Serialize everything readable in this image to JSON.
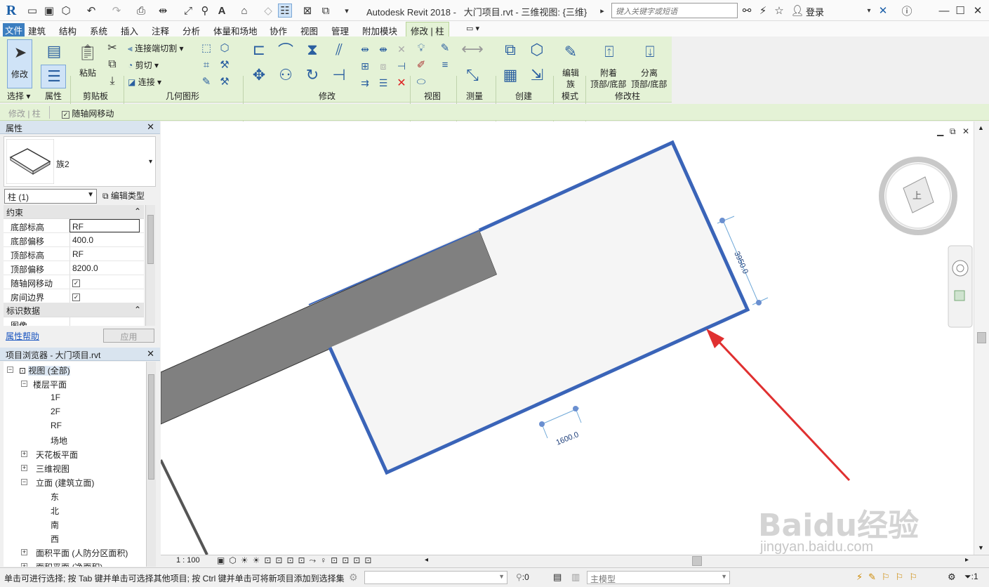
{
  "title": {
    "app": "Autodesk Revit 2018 -",
    "doc": "大门项目.rvt - 三维视图: {三维}",
    "search_placeholder": "键入关键字或短语",
    "login": "登录"
  },
  "menu": [
    "文件",
    "建筑",
    "结构",
    "系统",
    "插入",
    "注释",
    "分析",
    "体量和场地",
    "协作",
    "视图",
    "管理",
    "附加模块",
    "修改 | 柱"
  ],
  "ribbon": {
    "modify": "修改",
    "select_panel": "选择",
    "properties_panel": "属性",
    "paste": "粘贴",
    "clipboard_panel": "剪贴板",
    "join_cut": "连接端切割",
    "cut": "剪切",
    "join": "连接",
    "geometry_panel": "几何图形",
    "modify_panel": "修改",
    "view_panel": "视图",
    "measure_panel": "测量",
    "create_panel": "创建",
    "edit_family_1": "编辑",
    "edit_family_2": "族",
    "mode_panel": "模式",
    "attach_1": "附着",
    "attach_2": "顶部/底部",
    "detach_1": "分离",
    "detach_2": "顶部/底部",
    "modify_column_panel": "修改柱"
  },
  "options_bar": {
    "context": "修改 | 柱",
    "move_with_grids": "随轴网移动"
  },
  "properties": {
    "title": "属性",
    "type_name": "族2",
    "instance_select": "柱 (1)",
    "edit_type": "编辑类型",
    "groups": [
      {
        "name": "约束",
        "rows": [
          {
            "key": "底部标高",
            "value": "RF"
          },
          {
            "key": "底部偏移",
            "value": "400.0"
          },
          {
            "key": "顶部标高",
            "value": "RF"
          },
          {
            "key": "顶部偏移",
            "value": "8200.0"
          },
          {
            "key": "随轴网移动",
            "value": "✓"
          },
          {
            "key": "房间边界",
            "value": "✓"
          }
        ]
      },
      {
        "name": "标识数据",
        "rows": [
          {
            "key": "图像",
            "value": ""
          }
        ]
      }
    ],
    "help_link": "属性帮助",
    "apply": "应用"
  },
  "browser": {
    "title": "项目浏览器 - 大门项目.rvt",
    "items": [
      {
        "label": "视图 (全部)"
      },
      {
        "label": "楼层平面"
      },
      {
        "label": "1F"
      },
      {
        "label": "2F"
      },
      {
        "label": "RF"
      },
      {
        "label": "场地"
      },
      {
        "label": "天花板平面"
      },
      {
        "label": "三维视图"
      },
      {
        "label": "立面 (建筑立面)"
      },
      {
        "label": "东"
      },
      {
        "label": "北"
      },
      {
        "label": "南"
      },
      {
        "label": "西"
      },
      {
        "label": "面积平面 (人防分区面积)"
      },
      {
        "label": "面积平面 (净面积)"
      }
    ]
  },
  "canvas": {
    "dim_height": "3950.0",
    "dim_width": "1600.0",
    "viewcube_face": "上"
  },
  "view_bar": {
    "scale": "1 : 100"
  },
  "status": {
    "text": "单击可进行选择; 按 Tab 键并单击可选择其他项目; 按 Ctrl 键并单击可将新项目添加到选择集",
    "worksets": ":0",
    "model": "主模型",
    "filter": ":1"
  },
  "watermark": {
    "brand": "Baidu经验",
    "url": "jingyan.baidu.com"
  }
}
